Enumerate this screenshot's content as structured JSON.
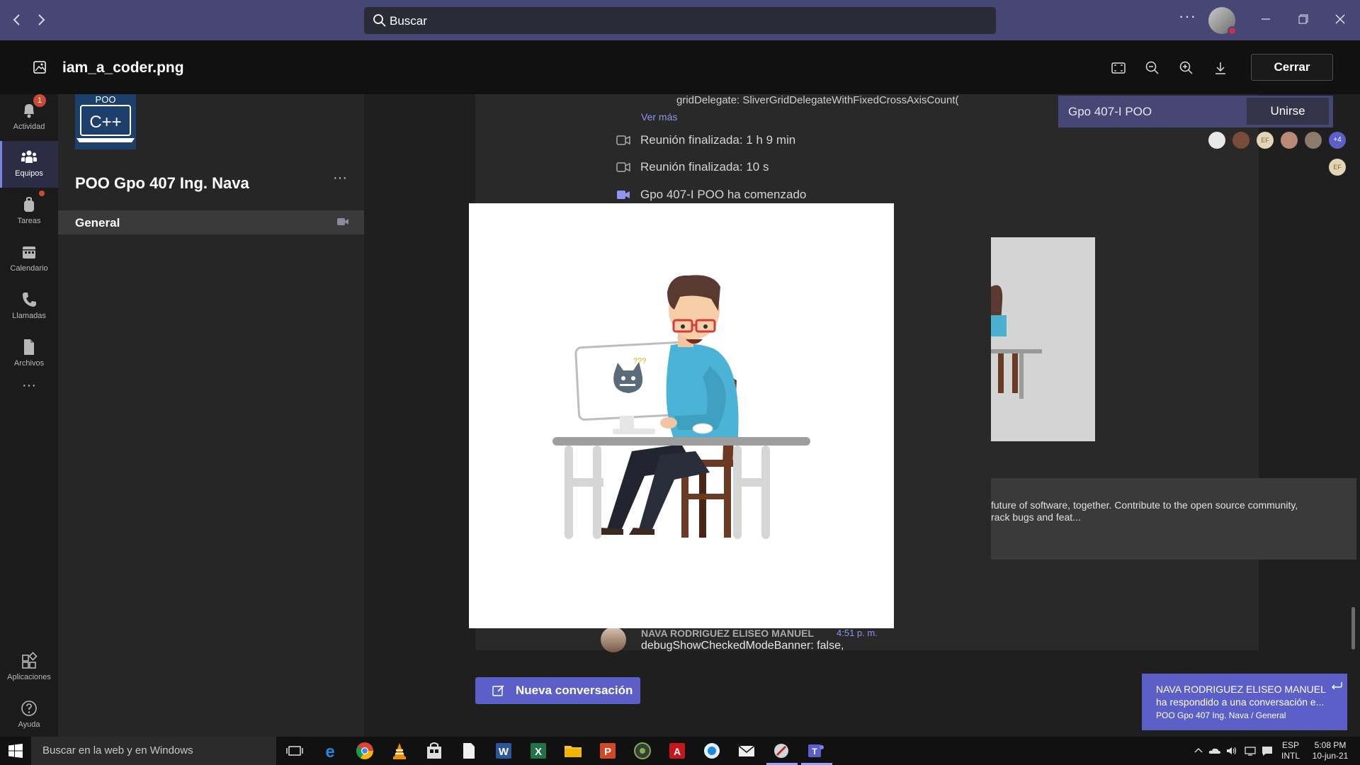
{
  "titlebar": {
    "back_icon": "chevron-left-icon",
    "forward_icon": "chevron-right-icon",
    "search_placeholder": "Buscar",
    "more_label": "···"
  },
  "viewer": {
    "file_name": "iam_a_coder.png",
    "tools": [
      "fit-screen-icon",
      "zoom-out-icon",
      "zoom-in-icon",
      "download-icon"
    ],
    "close_label": "Cerrar"
  },
  "rail": {
    "items": [
      {
        "label": "Actividad",
        "badge": "1"
      },
      {
        "label": "Equipos"
      },
      {
        "label": "Tareas"
      },
      {
        "label": "Calendario"
      },
      {
        "label": "Llamadas"
      },
      {
        "label": "Archivos"
      },
      {
        "label": "Aplicaciones"
      },
      {
        "label": "Ayuda"
      }
    ],
    "more_label": "···"
  },
  "team": {
    "logo_top": "POO",
    "logo_main": "C++",
    "name": "POO Gpo 407 Ing. Nava",
    "more_label": "···",
    "channel": "General"
  },
  "chat": {
    "code_snippet": "gridDelegate: SliverGridDelegateWithFixedCrossAxisCount(",
    "see_more": "Ver más",
    "meetings": [
      "Reunión finalizada: 1 h 9 min",
      "Reunión finalizada: 10 s",
      "Gpo 407-I POO ha comenzado"
    ],
    "avatar_extra": "+4",
    "avatar_initials": "EF",
    "link_card_text_1": "future of software, together. Contribute to the open source community,",
    "link_card_text_2": "rack bugs and feat...",
    "message": {
      "author": "NAVA RODRIGUEZ ELISEO MANUEL",
      "time": "4:51 p. m.",
      "text": "debugShowCheckedModeBanner: false,"
    },
    "new_conversation": "Nueva conversación"
  },
  "join_banner": {
    "title": "Gpo 407-I POO",
    "button": "Unirse"
  },
  "toast": {
    "line1": "NAVA RODRIGUEZ ELISEO MANUEL",
    "line2": "ha respondido a una conversación e...",
    "line3": "POO Gpo 407 Ing. Nava / General"
  },
  "taskbar": {
    "search_placeholder": "Buscar en la web y en Windows",
    "lang_top": "ESP",
    "lang_bottom": "INTL",
    "time": "5:08 PM",
    "date": "10-jun-21"
  },
  "colors": {
    "titlebar": "#464775",
    "accent": "#5b5fc7",
    "badge": "#cc4a31"
  }
}
